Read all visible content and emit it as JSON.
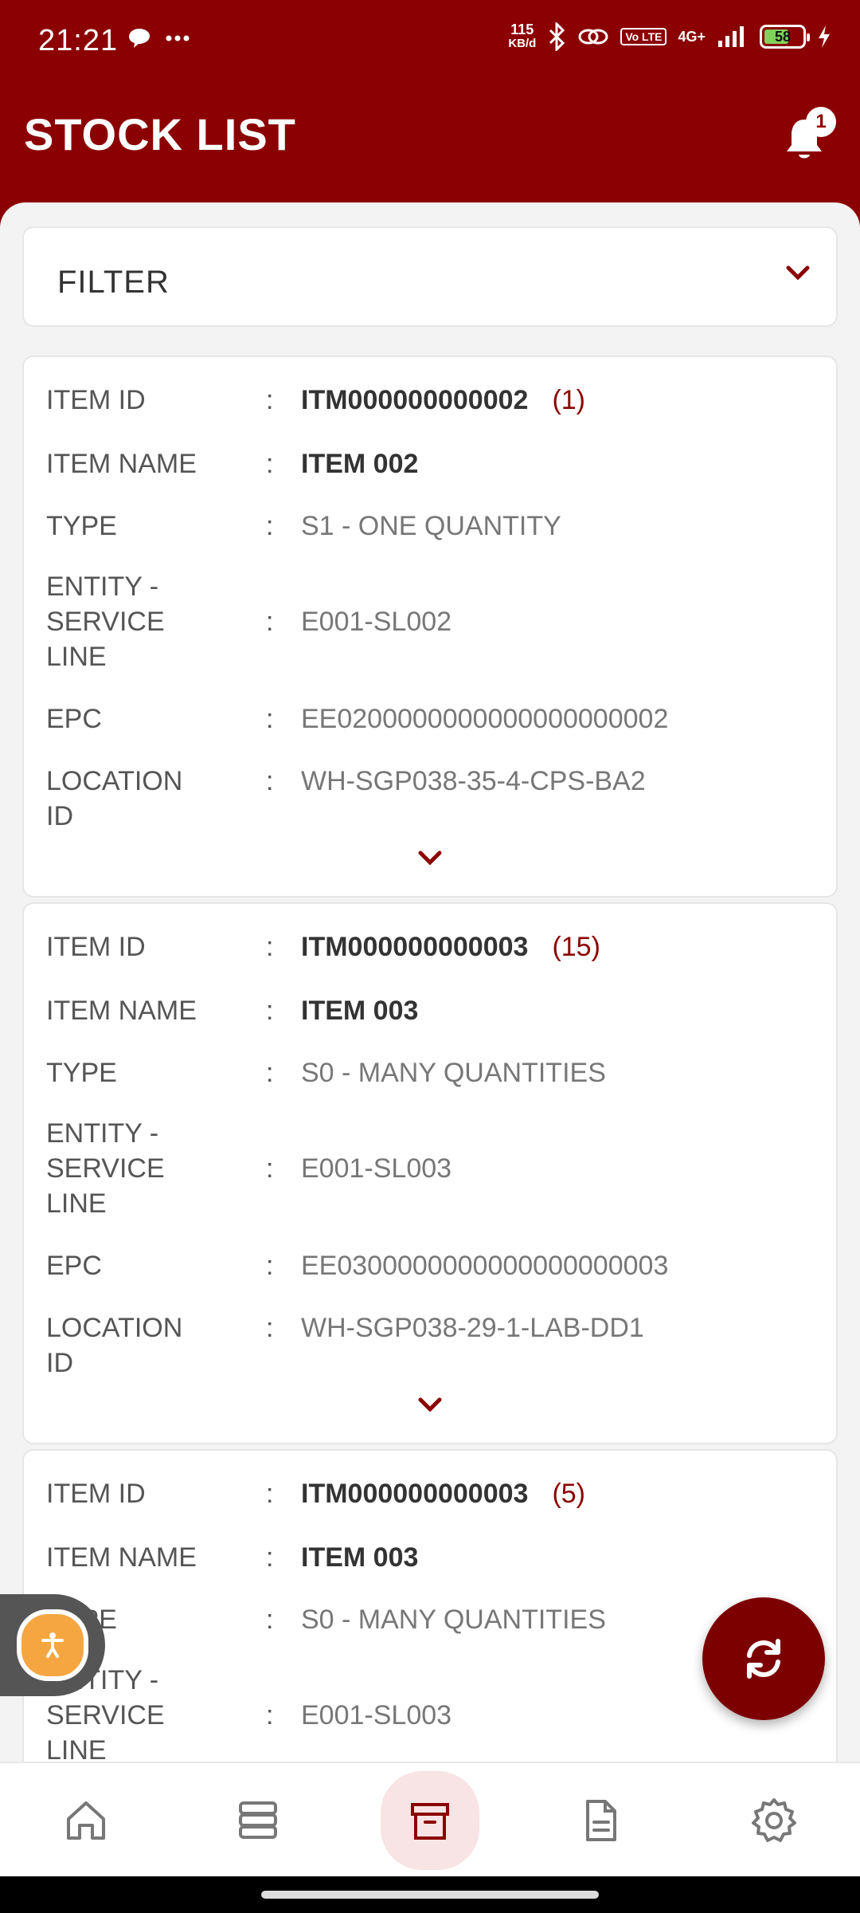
{
  "status_bar": {
    "time": "21:21",
    "net_speed_value": "115",
    "net_speed_unit": "KB/d",
    "lte_label": "Vo LTE",
    "signal_label": "4G+",
    "battery": "58"
  },
  "header": {
    "title": "STOCK LIST",
    "notification_count": "1"
  },
  "filter": {
    "label": "FILTER"
  },
  "labels": {
    "item_id": "ITEM ID",
    "item_name": "ITEM NAME",
    "type": "TYPE",
    "entity": "ENTITY - SERVICE LINE",
    "epc": "EPC",
    "location": "LOCATION ID",
    "colon": ":"
  },
  "items": [
    {
      "item_id": "ITM000000000002",
      "qty": "(1)",
      "item_name": "ITEM 002",
      "type": "S1 - ONE QUANTITY",
      "entity": "E001-SL002",
      "epc": "EE0200000000000000000002",
      "location": "WH-SGP038-35-4-CPS-BA2"
    },
    {
      "item_id": "ITM000000000003",
      "qty": "(15)",
      "item_name": "ITEM 003",
      "type": "S0 - MANY QUANTITIES",
      "entity": "E001-SL003",
      "epc": "EE0300000000000000000003",
      "location": "WH-SGP038-29-1-LAB-DD1"
    },
    {
      "item_id": "ITM000000000003",
      "qty": "(5)",
      "item_name": "ITEM 003",
      "type": "S0 - MANY QUANTITIES",
      "entity": "E001-SL003"
    }
  ],
  "colors": {
    "primary": "#8b0000",
    "background": "#f3f3f3",
    "accent_orange": "#f5a640"
  },
  "bottom_nav": [
    {
      "icon": "home-icon"
    },
    {
      "icon": "database-icon"
    },
    {
      "icon": "archive-icon",
      "active": true
    },
    {
      "icon": "document-icon"
    },
    {
      "icon": "settings-icon"
    }
  ]
}
